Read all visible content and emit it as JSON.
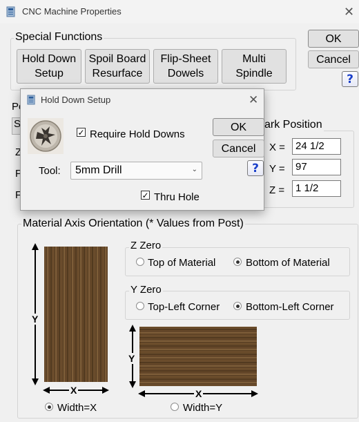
{
  "window": {
    "title": "CNC Machine Properties",
    "close_glyph": "✕"
  },
  "special_functions": {
    "legend": "Special Functions",
    "buttons": [
      {
        "line1": "Hold Down",
        "line2": "Setup"
      },
      {
        "line1": "Spoil Board",
        "line2": "Resurface"
      },
      {
        "line1": "Flip-Sheet",
        "line2": "Dowels"
      },
      {
        "line1": "Multi",
        "line2": "Spindle"
      }
    ]
  },
  "main_buttons": {
    "ok": "OK",
    "cancel": "Cancel",
    "help": "?"
  },
  "partial_labels": {
    "po": "Po",
    "s": "S",
    "z": "Z",
    "p": "P",
    "f": "F"
  },
  "park_position": {
    "legend": "ark Position",
    "x_label": "X =",
    "x_value": "24 1/2",
    "y_label": "Y =",
    "y_value": "97",
    "z_label": "Z =",
    "z_value": "1 1/2"
  },
  "material_axis": {
    "legend": "Material Axis Orientation (* Values from Post)",
    "z_zero": {
      "legend": "Z Zero",
      "options": [
        "Top of Material",
        "Bottom of Material"
      ],
      "selected": "Bottom of Material"
    },
    "y_zero": {
      "legend": "Y Zero",
      "options": [
        "Top-Left Corner",
        "Bottom-Left Corner"
      ],
      "selected": "Bottom-Left Corner"
    },
    "axis_labels": {
      "y": "Y",
      "x": "X"
    },
    "width_options": [
      "Width=X",
      "Width=Y"
    ],
    "width_selected": "Width=X"
  },
  "hold_down_dialog": {
    "title": "Hold Down Setup",
    "close_glyph": "✕",
    "require_label": "Require Hold Downs",
    "require_checked": true,
    "tool_label": "Tool:",
    "tool_value": "5mm Drill",
    "thru_hole_label": "Thru Hole",
    "thru_hole_checked": true,
    "ok": "OK",
    "cancel": "Cancel",
    "help": "?"
  },
  "check_glyph": "✓",
  "colors": {
    "help_blue": "#1a3fc9",
    "wood_dark": "#4b331b",
    "wood_light": "#8a6840"
  }
}
